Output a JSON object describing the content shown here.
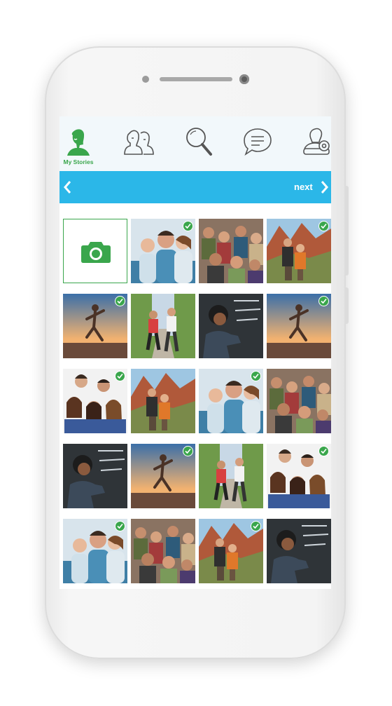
{
  "tabs": [
    {
      "id": "my-stories",
      "label": "My Stories",
      "icon": "person-profile-icon",
      "active": true
    },
    {
      "id": "friends",
      "label": "",
      "icon": "two-people-icon",
      "active": false
    },
    {
      "id": "search",
      "label": "",
      "icon": "search-icon",
      "active": false
    },
    {
      "id": "messages",
      "label": "",
      "icon": "chat-bubble-icon",
      "active": false
    },
    {
      "id": "profile-settings",
      "label": "",
      "icon": "user-settings-icon",
      "active": false
    }
  ],
  "navbar": {
    "back_icon": "chevron-left-icon",
    "next_label": "next",
    "next_icon": "chevron-right-icon"
  },
  "colors": {
    "accent_green": "#3aa64c",
    "nav_blue": "#2bb7e8",
    "tabbar_bg": "#f2f8fb"
  },
  "add_tile": {
    "icon": "camera-icon"
  },
  "photos": [
    {
      "scene": "family",
      "selected": true
    },
    {
      "scene": "crowd",
      "selected": false
    },
    {
      "scene": "hiking-canyon",
      "selected": true
    },
    {
      "scene": "runner-sunset",
      "selected": true
    },
    {
      "scene": "couple-jogging",
      "selected": false
    },
    {
      "scene": "chalkboard-writer",
      "selected": false
    },
    {
      "scene": "runner-sunset",
      "selected": true
    },
    {
      "scene": "friends-group",
      "selected": true
    },
    {
      "scene": "hiking-canyon",
      "selected": false
    },
    {
      "scene": "family",
      "selected": true
    },
    {
      "scene": "crowd",
      "selected": false
    },
    {
      "scene": "chalkboard-writer",
      "selected": false
    },
    {
      "scene": "runner-sunset",
      "selected": true
    },
    {
      "scene": "couple-jogging",
      "selected": false
    },
    {
      "scene": "friends-group",
      "selected": true
    },
    {
      "scene": "family",
      "selected": true
    },
    {
      "scene": "crowd",
      "selected": false
    },
    {
      "scene": "hiking-canyon",
      "selected": true
    },
    {
      "scene": "chalkboard-writer",
      "selected": false
    }
  ]
}
